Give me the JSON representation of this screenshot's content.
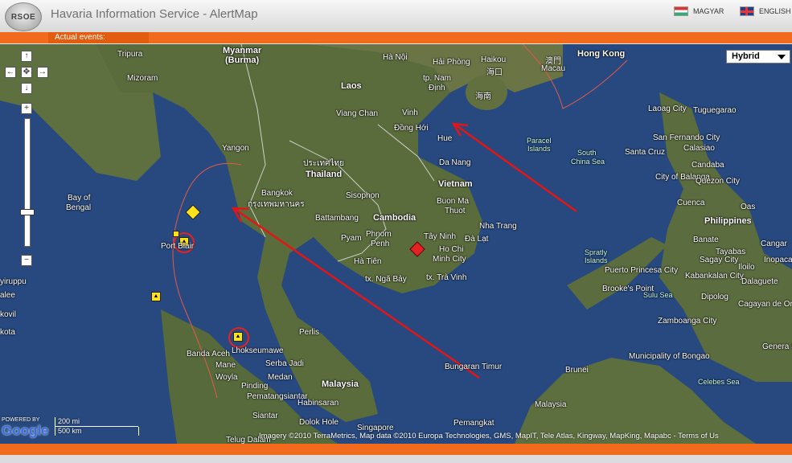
{
  "header": {
    "logo_text": "RSOE",
    "title": "Havaria Information Service - AlertMap",
    "lang_hu": "MAGYAR",
    "lang_en": "ENGLISH"
  },
  "tabs": {
    "actual_events": "Actual events:"
  },
  "map": {
    "type_selector": "Hybrid",
    "nav_up": "↑",
    "nav_left": "←",
    "nav_center": "✥",
    "nav_right": "→",
    "nav_down": "↓",
    "zoom_in": "+",
    "zoom_out": "−",
    "scale_mi": "200 mi",
    "scale_km": "500 km",
    "copyright": "Imagery ©2010 TerraMetrics, Map data ©2010 Europa Technologies, GMS, MapIT, Tele Atlas, Kingway, MapKing, Mapabc - Terms of Us",
    "powered_by": "POWERED BY",
    "google": "Google",
    "labels": [
      "Tripura",
      "Myanmar",
      "(Burma)",
      "Mizoram",
      "Hà Nội",
      "Hải Phòng",
      "Haikou",
      "海口",
      "澳門",
      "Macau",
      "Hong Kong",
      "Laos",
      "tp. Nam",
      "Định",
      "海南",
      "Vinh",
      "Viang Chan",
      "Đồng Hới",
      "Hue",
      "Yangon",
      "Thailand",
      "ประเทศไทย",
      "Bangkok",
      "กรุงเทพมหานคร",
      "Da Nang",
      "Vietnam",
      "Buon Ma",
      "Thuot",
      "Cambodia",
      "Phnom",
      "Penh",
      "Tây Ninh",
      "Ho Chi",
      "Minh City",
      "Nha Trang",
      "Đà Lạt",
      "Pyam",
      "Hà Tiên",
      "tx. Ngã Bảy",
      "tx. Trà Vinh",
      "Battambang",
      "Sisophon",
      "Bay of",
      "Bengal",
      "Paracel",
      "Islands",
      "South",
      "China Sea",
      "Spratly",
      "Islands",
      "Laoag City",
      "Tuguegarao",
      "Santa Cruz",
      "Calasiao",
      "Candaba",
      "San Fernando City",
      "City of Balanga",
      "Quezon City",
      "Cuenca",
      "Oas",
      "Philippines",
      "Banate",
      "Cangar",
      "Tayabas",
      "Sagay City",
      "Iloilo",
      "Inopaca",
      "Kabankalan City",
      "Dalaguete",
      "Puerto Princesa City",
      "Brooke's Point",
      "Sulu Sea",
      "Dipolog",
      "Cagayan de Oro",
      "Zamboanga City",
      "Genera Santos",
      "Brunei",
      "Malaysia",
      "Municipality of Bongao",
      "Celebes Sea",
      "Bungaran Timur",
      "Perlis",
      "Malaysia",
      "Medan",
      "Pematangsiantar",
      "Singapore",
      "Pemangkat",
      "Lhokseumawe",
      "Banda Aceh",
      "Serba Jadi",
      "Mane",
      "Woyla",
      "Pinding",
      "Habinsaran",
      "Dolok Hole",
      "Siantar",
      "Telug Dalam",
      "Port Blair",
      "yiruppu",
      "alee",
      "kovil",
      "kota"
    ]
  }
}
